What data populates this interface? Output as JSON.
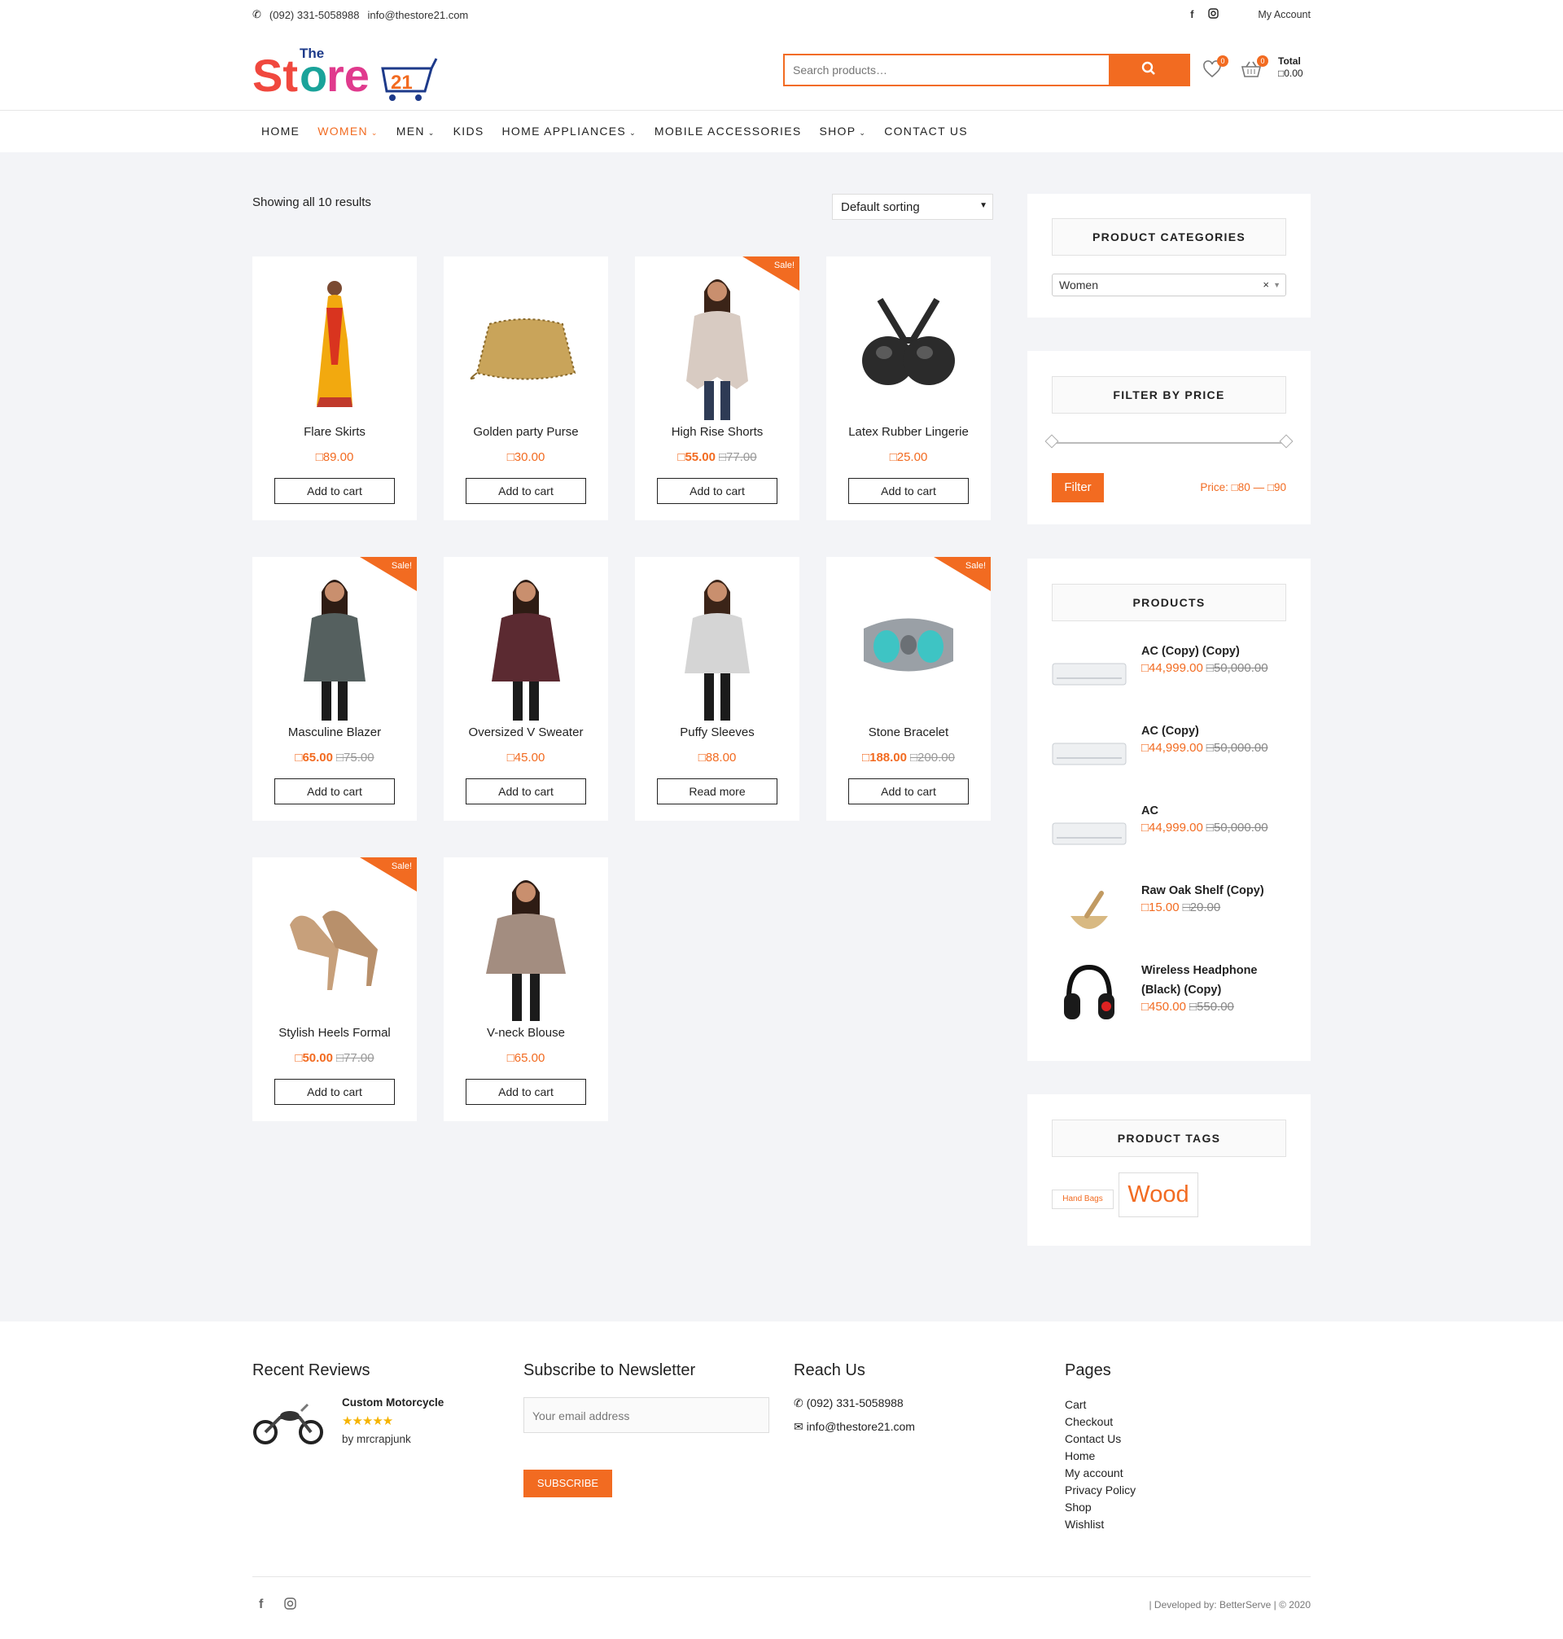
{
  "topbar": {
    "phone": "(092) 331-5058988",
    "email": "info@thestore21.com",
    "account": "My Account"
  },
  "header": {
    "logo_text": "The Store 21",
    "search_placeholder": "Search products…",
    "wishlist_count": "0",
    "cart_count": "0",
    "total_label": "Total",
    "total_value": "□0.00"
  },
  "nav": [
    {
      "label": "HOME",
      "dropdown": false
    },
    {
      "label": "WOMEN",
      "dropdown": true,
      "active": true
    },
    {
      "label": "MEN",
      "dropdown": true
    },
    {
      "label": "KIDS",
      "dropdown": false
    },
    {
      "label": "HOME APPLIANCES",
      "dropdown": true
    },
    {
      "label": "MOBILE ACCESSORIES",
      "dropdown": false
    },
    {
      "label": "SHOP",
      "dropdown": true
    },
    {
      "label": "CONTACT US",
      "dropdown": false
    }
  ],
  "shop": {
    "results": "Showing all 10 results",
    "sorting": "Default sorting"
  },
  "products": [
    {
      "name": "Flare Skirts",
      "price": "□89.00",
      "old": "",
      "sale": false,
      "button": "Add to cart"
    },
    {
      "name": "Golden party Purse",
      "price": "□30.00",
      "old": "",
      "sale": false,
      "button": "Add to cart"
    },
    {
      "name": "High Rise Shorts",
      "price": "□55.00",
      "old": "□77.00",
      "sale": true,
      "button": "Add to cart"
    },
    {
      "name": "Latex Rubber Lingerie",
      "price": "□25.00",
      "old": "",
      "sale": false,
      "button": "Add to cart"
    },
    {
      "name": "Masculine Blazer",
      "price": "□65.00",
      "old": "□75.00",
      "sale": true,
      "button": "Add to cart"
    },
    {
      "name": "Oversized V Sweater",
      "price": "□45.00",
      "old": "",
      "sale": false,
      "button": "Add to cart"
    },
    {
      "name": "Puffy Sleeves",
      "price": "□88.00",
      "old": "",
      "sale": false,
      "button": "Read more"
    },
    {
      "name": "Stone Bracelet",
      "price": "□188.00",
      "old": "□200.00",
      "sale": true,
      "button": "Add to cart"
    },
    {
      "name": "Stylish Heels Formal",
      "price": "□50.00",
      "old": "□77.00",
      "sale": true,
      "button": "Add to cart"
    },
    {
      "name": "V-neck Blouse",
      "price": "□65.00",
      "old": "",
      "sale": false,
      "button": "Add to cart"
    }
  ],
  "sale_label": "Sale!",
  "sidebar": {
    "categories_title": "PRODUCT CATEGORIES",
    "category_selected": "Women",
    "price_title": "FILTER BY PRICE",
    "filter_button": "Filter",
    "price_label": "Price:",
    "price_min": "□80",
    "price_sep": "—",
    "price_max": "□90",
    "products_title": "PRODUCTS",
    "products": [
      {
        "name": "AC (Copy) (Copy)",
        "price": "□44,999.00",
        "old": "□50,000.00"
      },
      {
        "name": "AC (Copy)",
        "price": "□44,999.00",
        "old": "□50,000.00"
      },
      {
        "name": "AC",
        "price": "□44,999.00",
        "old": "□50,000.00"
      },
      {
        "name": "Raw Oak Shelf (Copy)",
        "price": "□15.00",
        "old": "□20.00"
      },
      {
        "name": "Wireless Headphone (Black) (Copy)",
        "price": "□450.00",
        "old": "□550.00"
      }
    ],
    "tags_title": "PRODUCT TAGS",
    "tags": [
      "Hand Bags",
      "Wood"
    ]
  },
  "footer": {
    "reviews_title": "Recent Reviews",
    "review_product": "Custom Motorcycle",
    "review_stars": "★★★★★",
    "review_by": "by mrcrapjunk",
    "newsletter_title": "Subscribe to Newsletter",
    "newsletter_placeholder": "Your email address",
    "subscribe": "SUBSCRIBE",
    "reach_title": "Reach Us",
    "reach_phone": "(092) 331-5058988",
    "reach_email": "info@thestore21.com",
    "pages_title": "Pages",
    "pages": [
      "Cart",
      "Checkout",
      "Contact Us",
      "Home",
      "My account",
      "Privacy Policy",
      "Shop",
      "Wishlist"
    ],
    "credit": "| Developed by: BetterServe | © 2020"
  },
  "colors": {
    "accent": "#f26b21",
    "background": "#f3f4f7"
  }
}
